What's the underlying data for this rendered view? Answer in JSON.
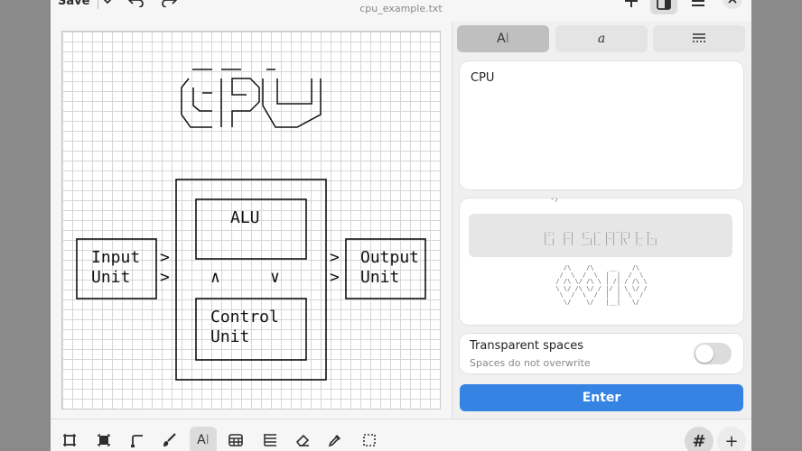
{
  "header": {
    "save_label": "Save",
    "title": "cpu_example.txt"
  },
  "canvas": {
    "ascii_art": "    ___ ___ _   _\n   / __| _ \\ | | |\n  | (__|  _/ |_| |\n   \\___|_|  \\___/\n\n\n     ┌────────────┐\n     │ ┌────────┐ │\n     │ │   ALU  │ │\n     │ │        │ │\n┌───┐│ └────────┘ │┌───┐\n│ Input │ > │ ... │"
  },
  "sidebar": {
    "tabs": [
      {
        "name": "text",
        "label": "A|"
      },
      {
        "name": "font",
        "label": "a"
      },
      {
        "name": "more",
        "label": "▦"
      }
    ],
    "text_value": "CPU",
    "transparent_spaces": {
      "title": "Transparent spaces",
      "subtitle": "Spaces do not overwrite",
      "enabled": false
    },
    "enter_label": "Enter"
  },
  "toolbar": {
    "grid_label": "#",
    "add_label": "+"
  },
  "colors": {
    "accent": "#3584e4",
    "tab_active": "#bfbfbf"
  }
}
